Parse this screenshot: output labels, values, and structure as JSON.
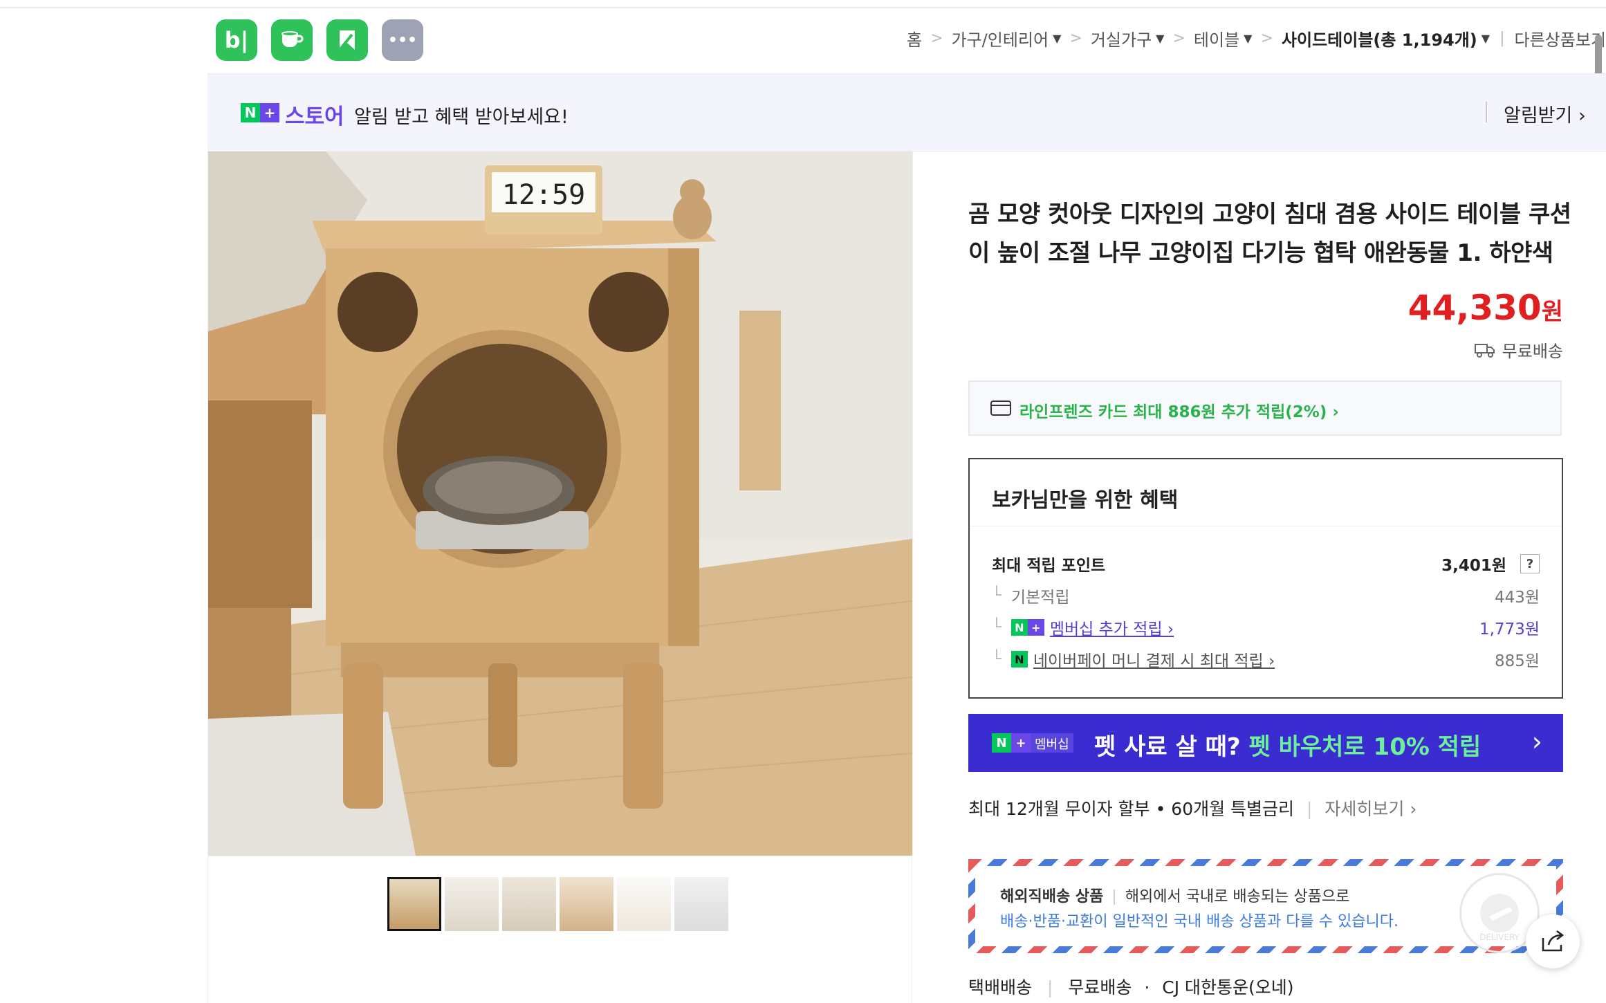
{
  "app_icons": [
    {
      "name": "blog",
      "glyph": "b|",
      "color": "#2fc15a"
    },
    {
      "name": "cafe",
      "glyph": "☕",
      "color": "#2fc15a"
    },
    {
      "name": "bookmark",
      "glyph": "",
      "color": "#2fc15a"
    },
    {
      "name": "more",
      "glyph": "•••",
      "color": "#9ea3b4"
    }
  ],
  "breadcrumb": {
    "home": "홈",
    "cat1": "가구/인테리어",
    "cat2": "거실가구",
    "cat3": "테이블",
    "current": "사이드테이블(총 1,194개)",
    "other": "다른상품보기"
  },
  "store_banner": {
    "store_label": "스토어",
    "message": "알림 받고 혜택 받아보세요!",
    "action": "알림받기 ›"
  },
  "product": {
    "title": "곰 모양 컷아웃 디자인의 고양이 침대 겸용 사이드 테이블 쿠션이 높이 조절 나무 고양이집 다기능 협탁 애완동물 1. 하얀색",
    "price": "44,330",
    "currency": "원",
    "shipping": "무료배송",
    "clock_display": "12:59"
  },
  "card_promo": "라인프렌즈 카드 최대 886원 추가 적립(2%) ›",
  "benefits": {
    "title": "보카님만을 위한 혜택",
    "max_label": "최대 적립 포인트",
    "max_value": "3,401원",
    "help": "?",
    "basic_label": "기본적립",
    "basic_value": "443원",
    "membership_label": "멤버십 추가 적립 ›",
    "membership_value": "1,773원",
    "npay_label": "네이버페이 머니 결제 시 최대 적립 ›",
    "npay_value": "885원"
  },
  "membership_banner": {
    "tag": "멤버십",
    "text_main": "펫 사료 살 때? ",
    "text_highlight": "펫 바우처로 10% 적립",
    "arrow": "›"
  },
  "installment": {
    "text": "최대 12개월 무이자 할부 • 60개월 특별금리",
    "more": "자세히보기 ›"
  },
  "overseas": {
    "label": "해외직배송 상품",
    "desc": "해외에서 국내로 배송되는 상품으로",
    "note": "배송·반품·교환이 일반적인 국내 배송 상품과 다를 수 있습니다.",
    "stamp_text": "DELIVERY"
  },
  "delivery": {
    "method": "택배배송",
    "fee": "무료배송",
    "carrier": "CJ 대한통운(오네)"
  },
  "colors": {
    "accent": "#3a2cd0",
    "price": "#e02020",
    "naver_green": "#03c75a",
    "store_purple": "#6b46e8"
  }
}
